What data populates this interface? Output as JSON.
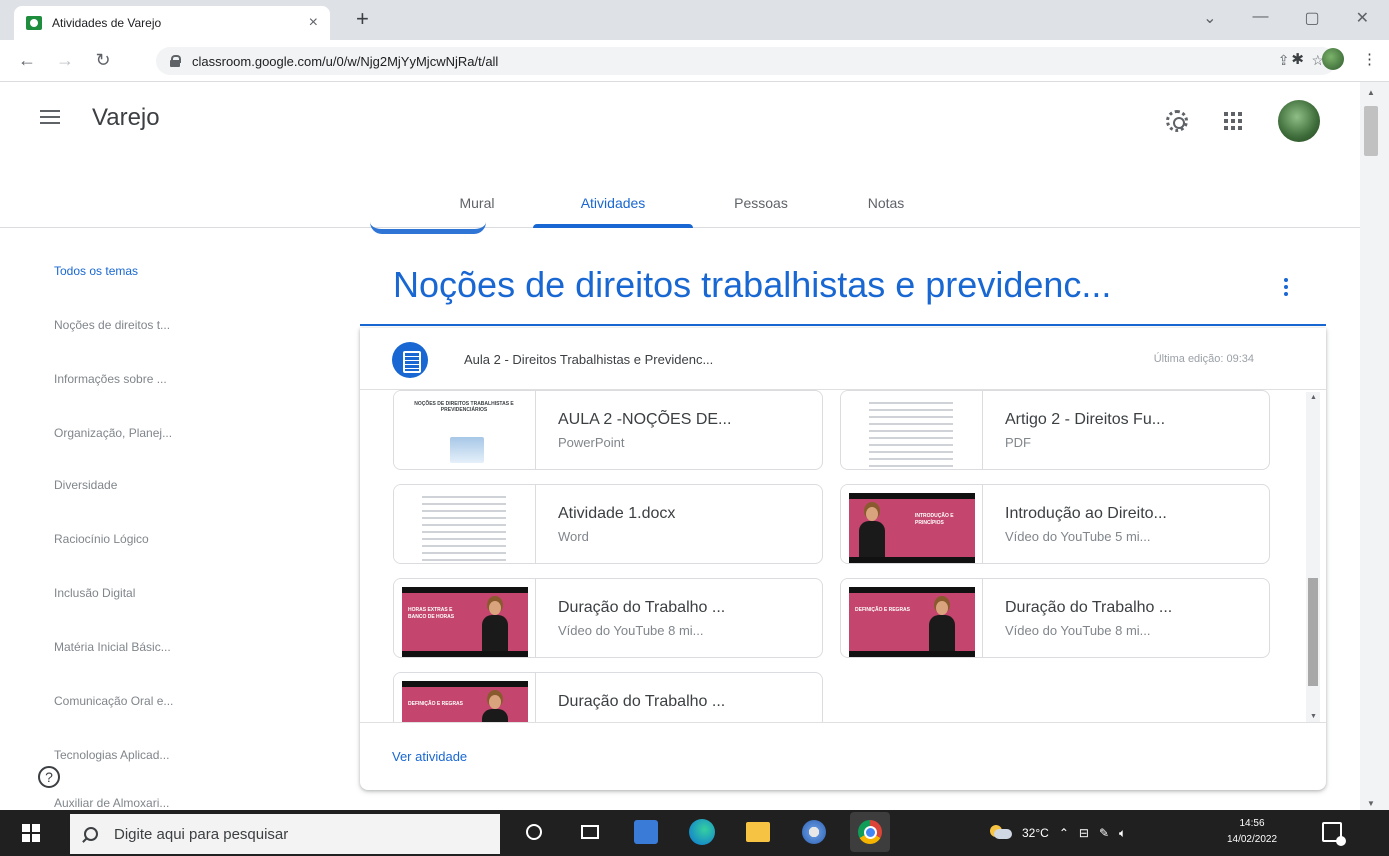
{
  "browser": {
    "tab_title": "Atividades de Varejo",
    "tab_close": "×",
    "new_tab": "+",
    "url": "classroom.google.com/u/0/w/Njg2MjYyMjcwNjRa/t/all",
    "window_controls": [
      "⌄",
      "—",
      "▢",
      "✕"
    ]
  },
  "header": {
    "class_name": "Varejo",
    "tabs": [
      "Mural",
      "Atividades",
      "Pessoas",
      "Notas"
    ],
    "active_tab": "Atividades"
  },
  "sidebar": {
    "items": [
      "Todos os temas",
      "Noções de direitos t...",
      "Informações sobre ...",
      "Organização, Planej...",
      "Diversidade",
      "Raciocínio Lógico",
      "Inclusão Digital",
      "Matéria Inicial Básic...",
      "Comunicação Oral e...",
      "Tecnologias Aplicad...",
      "Auxiliar de Almoxari..."
    ],
    "help": "?"
  },
  "topic": {
    "title": "Noções de direitos trabalhistas e previdenc..."
  },
  "assignment": {
    "title": "Aula 2 - Direitos Trabalhistas e Previdenc...",
    "last_edit": "Última edição: 09:34",
    "view_link": "Ver atividade",
    "attachments": [
      {
        "name": "AULA 2 -NOÇÕES DE...",
        "type": "PowerPoint",
        "thumb": "slide",
        "thumb_caption": "NOÇÕES DE DIREITOS TRABALHISTAS E PREVIDENCIÁRIOS"
      },
      {
        "name": "Artigo 2 - Direitos Fu...",
        "type": "PDF",
        "thumb": "document"
      },
      {
        "name": "Atividade 1.docx",
        "type": "Word",
        "thumb": "document"
      },
      {
        "name": "Introdução ao Direito...",
        "type": "Vídeo do YouTube   5 mi...",
        "thumb": "video",
        "thumb_caption": "INTRODUÇÃO E PRINCÍPIOS"
      },
      {
        "name": "Duração do Trabalho ...",
        "type": "Vídeo do YouTube   8 mi...",
        "thumb": "video",
        "thumb_caption": "HORAS EXTRAS E BANCO DE HORAS"
      },
      {
        "name": "Duração do Trabalho ...",
        "type": "Vídeo do YouTube   8 mi...",
        "thumb": "video",
        "thumb_caption": "DEFINIÇÃO E REGRAS"
      },
      {
        "name": "Duração do Trabalho ...",
        "type": "",
        "thumb": "video",
        "thumb_caption": "DEFINIÇÃO E REGRAS"
      }
    ]
  },
  "taskbar": {
    "search_placeholder": "Digite aqui para pesquisar",
    "temperature": "32°C",
    "time": "14:56",
    "date": "14/02/2022"
  },
  "colors": {
    "accent": "#1967d2",
    "video_thumb": "#c4466e",
    "taskbar": "#202020"
  }
}
